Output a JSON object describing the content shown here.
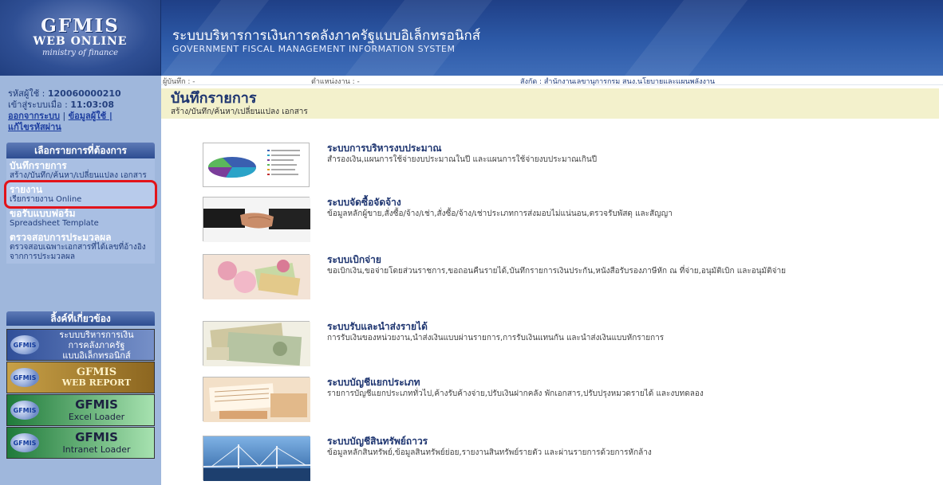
{
  "header": {
    "logo_line1": "GFMIS",
    "logo_line2": "WEB ONLINE",
    "logo_line3": "ministry of finance",
    "title_th": "ระบบบริหารการเงินการคลังภาครัฐแบบอิเล็กทรอนิกส์",
    "title_en": "GOVERNMENT FISCAL MANAGEMENT INFORMATION SYSTEM"
  },
  "user": {
    "id_label": "รหัสผู้ใช้ :",
    "id_value": "120060000210",
    "login_label": "เข้าสู่ระบบเมื่อ :",
    "login_time": "11:03:08",
    "logout_link": "ออกจากระบบ",
    "separator": "|",
    "profile_link": "ข้อมูลผู้ใช้ |",
    "change_password_link": "แก้ไขรหัสผ่าน"
  },
  "infobar": {
    "recorder": "ผู้บันทึก : -",
    "position": "ตำแหน่งงาน : -",
    "affiliation": "สังกัด : สำนักงานเลขานุการกรม สนง.นโยบายและแผนพลังงาน"
  },
  "menu": {
    "header": "เลือกรายการที่ต้องการ",
    "items": [
      {
        "title": "บันทึกรายการ",
        "sub": "สร้าง/บันทึก/ค้นหา/เปลี่ยนแปลง เอกสาร"
      },
      {
        "title": "รายงาน",
        "sub": "เรียกรายงาน Online"
      },
      {
        "title": "ขอรับแบบฟอร์ม",
        "sub": "Spreadsheet Template"
      },
      {
        "title": "ตรวจสอบการประมวลผล",
        "sub": "ตรวจสอบเฉพาะเอกสารที่ได้เลขที่อ้างอิงจากการประมวลผล"
      }
    ]
  },
  "links": {
    "header": "ลิ้งค์ที่เกี่ยวข้อง",
    "badge": "GFMIS",
    "b1": [
      "ระบบบริหารการเงิน",
      "การคลังภาครัฐ",
      "แบบอิเล็กทรอนิกส์"
    ],
    "b2": [
      "GFMIS",
      "WEB REPORT"
    ],
    "b3": [
      "GFMIS",
      "Excel Loader"
    ],
    "b4": [
      "GFMIS",
      "Intranet Loader"
    ]
  },
  "page": {
    "title": "บันทึกรายการ",
    "subtitle": "สร้าง/บันทึก/ค้นหา/เปลี่ยนแปลง เอกสาร"
  },
  "modules": [
    {
      "title": "ระบบการบริหารงบประมาณ",
      "desc": "สำรองเงิน,แผนการใช้จ่ายงบประมาณในปี และแผนการใช้จ่ายงบประมาณเกินปี"
    },
    {
      "title": "ระบบจัดซื้อจัดจ้าง",
      "desc": "ข้อมูลหลักผู้ขาย,สั่งซื้อ/จ้าง/เช่า,สั่งซื้อ/จ้าง/เช่าประเภทการส่งมอบไม่แน่นอน,ตรวจรับพัสดุ และสัญญา"
    },
    {
      "title": "ระบบเบิกจ่าย",
      "desc": "ขอเบิกเงิน,ขอจ่ายโดยส่วนราชการ,ขอถอนคืนรายได้,บันทึกรายการเงินประกัน,หนังสือรับรองภาษีหัก ณ ที่จ่าย,อนุมัติเบิก และอนุมัติจ่าย"
    },
    {
      "title": "ระบบรับและนำส่งรายได้",
      "desc": "การรับเงินของหน่วยงาน,นำส่งเงินแบบผ่านรายการ,การรับเงินแทนกัน และนำส่งเงินแบบหักรายการ"
    },
    {
      "title": "ระบบบัญชีแยกประเภท",
      "desc": "รายการบัญชีแยกประเภททั่วไป,ค้างรับค้างจ่าย,ปรับเงินฝากคลัง พักเอกสาร,ปรับปรุงหมวดรายได้ และงบทดลอง"
    },
    {
      "title": "ระบบบัญชีสินทรัพย์ถาวร",
      "desc": "ข้อมูลหลักสินทรัพย์,ข้อมูลสินทรัพย์ย่อย,รายงานสินทรัพย์รายตัว และผ่านรายการด้วยการหักล้าง"
    }
  ]
}
